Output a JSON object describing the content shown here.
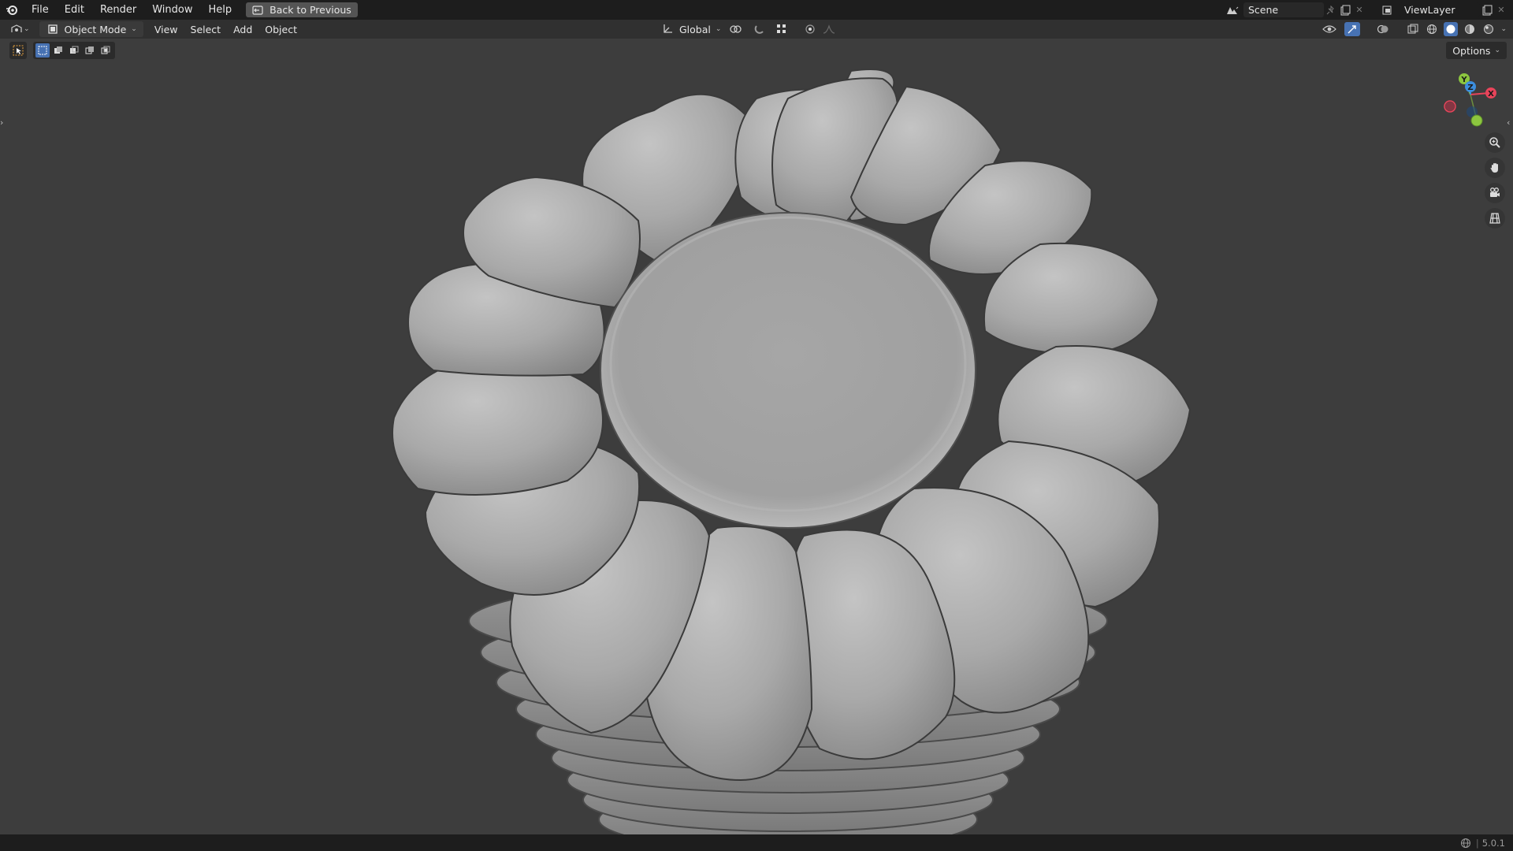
{
  "topbar": {
    "menu": [
      "File",
      "Edit",
      "Render",
      "Window",
      "Help"
    ],
    "back_label": "Back to Previous",
    "scene_name": "Scene",
    "viewlayer_name": "ViewLayer"
  },
  "header": {
    "mode_label": "Object Mode",
    "menus": [
      "View",
      "Select",
      "Add",
      "Object"
    ],
    "transform_orientation": "Global"
  },
  "options_label": "Options",
  "gizmo": {
    "x": "X",
    "y": "Y",
    "z": "Z"
  },
  "status": {
    "version": "5.0.1"
  },
  "colors": {
    "background": "#3d3d3d",
    "topbar": "#1d1d1d",
    "header": "#303030",
    "accent": "#4772b3",
    "x_axis": "#e8445a",
    "y_axis": "#8cc63f",
    "z_axis": "#3c8ede"
  },
  "icons": [
    "blender-logo",
    "back-icon",
    "scene-icon",
    "pin-icon",
    "new-scene-icon",
    "viewlayer-icon",
    "editor-type-icon",
    "object-mode-icon",
    "transform-orientation-icon",
    "pivot-icon",
    "snap-icon",
    "proportional-icon",
    "visibility-icon",
    "gizmo-icon",
    "overlay-icon",
    "xray-icon",
    "wireframe-icon",
    "solid-icon",
    "material-icon",
    "rendered-icon",
    "select-box-icon",
    "zoom-icon",
    "hand-icon",
    "camera-icon",
    "grid-icon",
    "globe-icon"
  ]
}
